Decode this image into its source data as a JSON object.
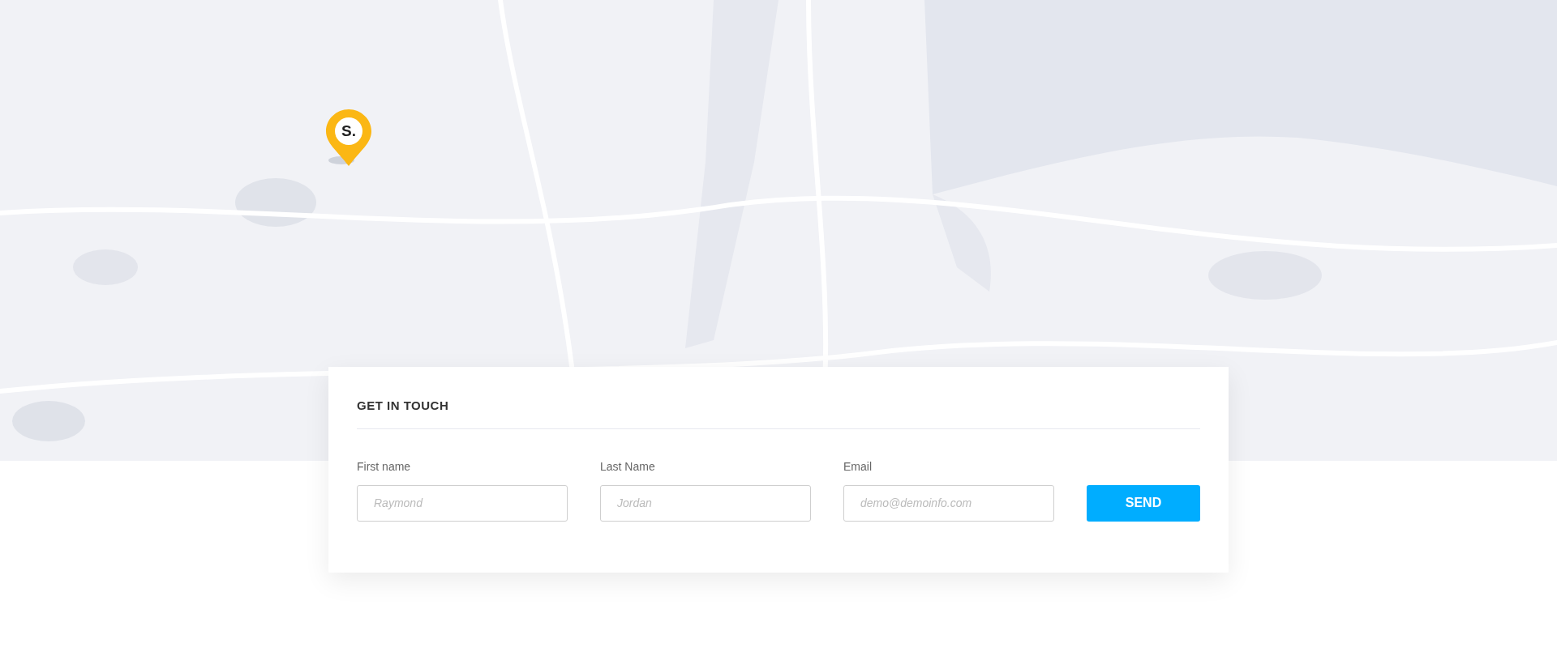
{
  "map": {
    "marker": {
      "label": "S."
    }
  },
  "contact_form": {
    "title": "GET IN TOUCH",
    "fields": [
      {
        "label": "First name",
        "placeholder": "Raymond"
      },
      {
        "label": "Last Name",
        "placeholder": "Jordan"
      },
      {
        "label": "Email",
        "placeholder": "demo@demoinfo.com"
      }
    ],
    "button": "SEND"
  }
}
